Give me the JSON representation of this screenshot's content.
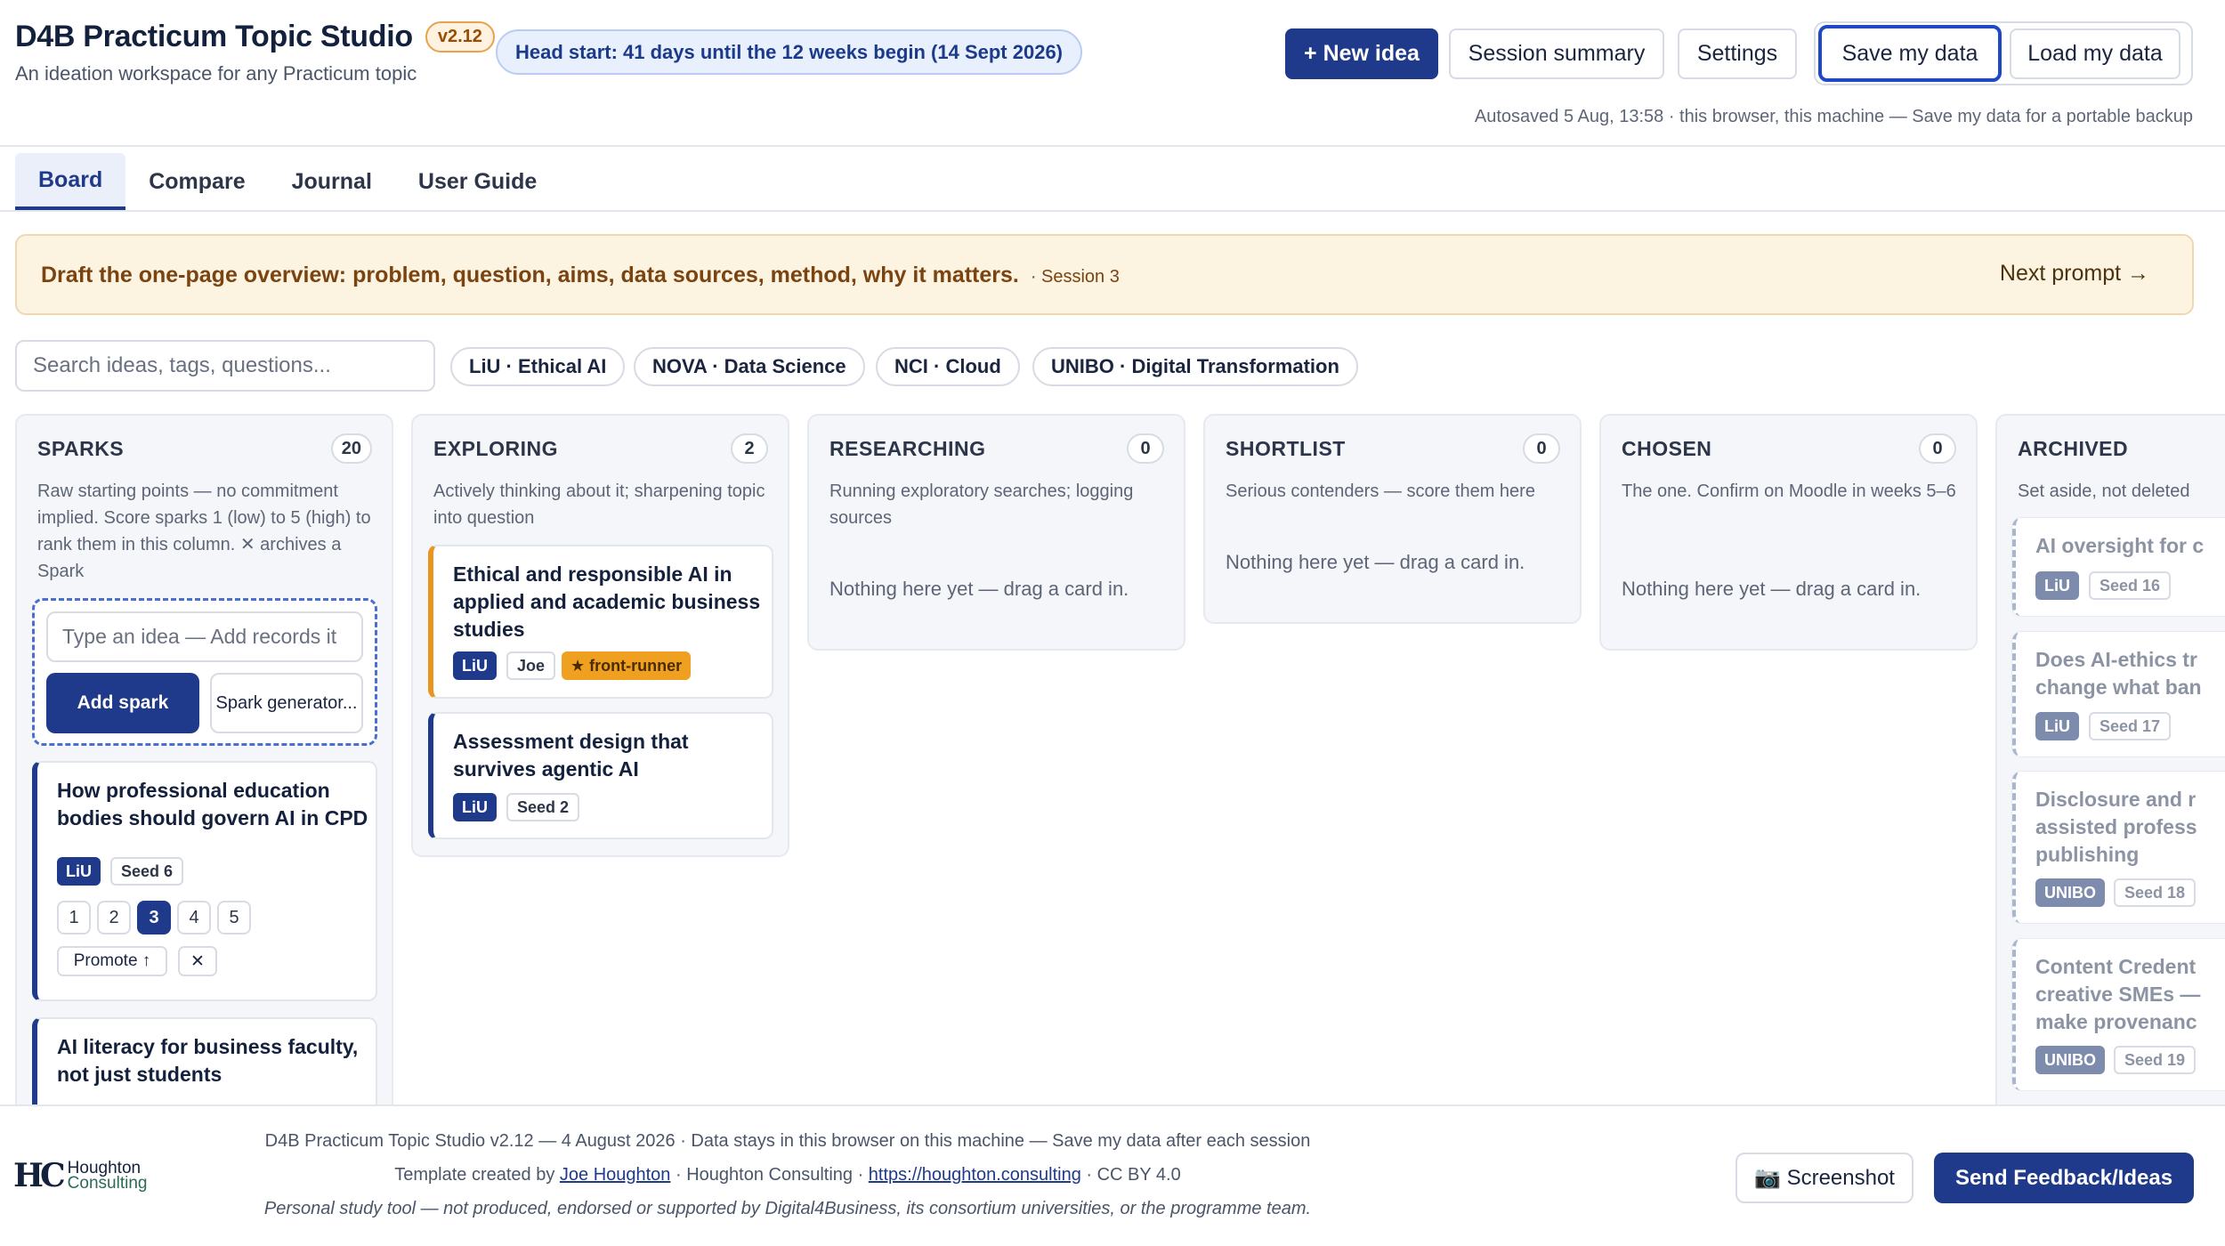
{
  "header": {
    "title": "D4B Practicum Topic Studio",
    "version": "v2.12",
    "headstart": "Head start: 41 days until the 12 weeks begin (14 Sept 2026)",
    "subtitle": "An ideation workspace for any Practicum topic",
    "new_idea": "+ New idea",
    "session_summary": "Session summary",
    "settings": "Settings",
    "save": "Save my data",
    "load": "Load my data",
    "autosave": "Autosaved 5 Aug, 13:58 · this browser, this machine — Save my data for a portable backup"
  },
  "tabs": [
    "Board",
    "Compare",
    "Journal",
    "User Guide"
  ],
  "prompt": {
    "text": "Draft the one-page overview: problem, question, aims, data sources, method, why it matters.",
    "session": "· Session 3",
    "next": "Next prompt →"
  },
  "search": {
    "placeholder": "Search ideas, tags, questions..."
  },
  "chips": [
    "LiU · Ethical AI",
    "NOVA · Data Science",
    "NCI · Cloud",
    "UNIBO · Digital Transformation"
  ],
  "columns": {
    "sparks": {
      "title": "SPARKS",
      "count": "20",
      "desc": "Raw starting points — no commitment implied. Score sparks 1 (low) to 5 (high) to rank them in this column. ✕ archives a Spark",
      "input_placeholder": "Type an idea — Add records it",
      "add_btn": "Add spark",
      "gen_btn": "Spark generator...",
      "cards": [
        {
          "title": "How professional education bodies should govern AI in CPD",
          "uni": "LiU",
          "seed": "Seed 6",
          "scores": [
            "1",
            "2",
            "3",
            "4",
            "5"
          ],
          "selected_score": "3",
          "promote": "Promote ↑",
          "archive": "✕"
        },
        {
          "title": "AI literacy for business faculty, not just students"
        }
      ]
    },
    "exploring": {
      "title": "EXPLORING",
      "count": "2",
      "desc": "Actively thinking about it; sharpening topic into question",
      "cards": [
        {
          "title": "Ethical and responsible AI in applied and academic business studies",
          "uni": "LiU",
          "owner": "Joe",
          "badge": "★ front-runner"
        },
        {
          "title": "Assessment design that survives agentic AI",
          "uni": "LiU",
          "seed": "Seed 2"
        }
      ]
    },
    "researching": {
      "title": "RESEARCHING",
      "count": "0",
      "desc": "Running exploratory searches; logging sources",
      "empty": "Nothing here yet — drag a card in."
    },
    "shortlist": {
      "title": "SHORTLIST",
      "count": "0",
      "desc": "Serious contenders — score them here",
      "empty": "Nothing here yet — drag a card in."
    },
    "chosen": {
      "title": "CHOSEN",
      "count": "0",
      "desc": "The one. Confirm on Moodle in weeks 5–6",
      "empty": "Nothing here yet — drag a card in."
    },
    "archived": {
      "title": "ARCHIVED",
      "desc": "Set aside, not deleted",
      "cards": [
        {
          "title": "AI oversight for c",
          "uni": "LiU",
          "seed": "Seed 16"
        },
        {
          "title1": "Does AI-ethics tr",
          "title2": "change what ban",
          "uni": "LiU",
          "seed": "Seed 17"
        },
        {
          "title1": "Disclosure and r",
          "title2": "assisted profess",
          "title3": "publishing",
          "uni": "UNIBO",
          "seed": "Seed 18"
        },
        {
          "title1": "Content Credent",
          "title2": "creative SMEs —",
          "title3": "make provenanc",
          "uni": "UNIBO",
          "seed": "Seed 19"
        }
      ]
    }
  },
  "footer": {
    "line1": "D4B Practicum Topic Studio v2.12 — 4 August 2026 · Data stays in this browser on this machine — Save my data after each session",
    "line2_a": "Template created by ",
    "line2_link1": "Joe Houghton",
    "line2_b": " · Houghton Consulting · ",
    "line2_link2": "https://houghton.consulting",
    "line2_c": " · CC BY 4.0",
    "line3": "Personal study tool — not produced, endorsed or supported by Digital4Business, its consortium universities, or the programme team.",
    "logo_mark": "HC",
    "logo_line1": "Houghton",
    "logo_line2": "Consulting",
    "screenshot": "📷 Screenshot",
    "feedback": "Send Feedback/Ideas"
  },
  "colors": {
    "primary": "#1f3a8a",
    "prompt_bg": "#fdf3e1",
    "front_runner": "#f0a021"
  }
}
